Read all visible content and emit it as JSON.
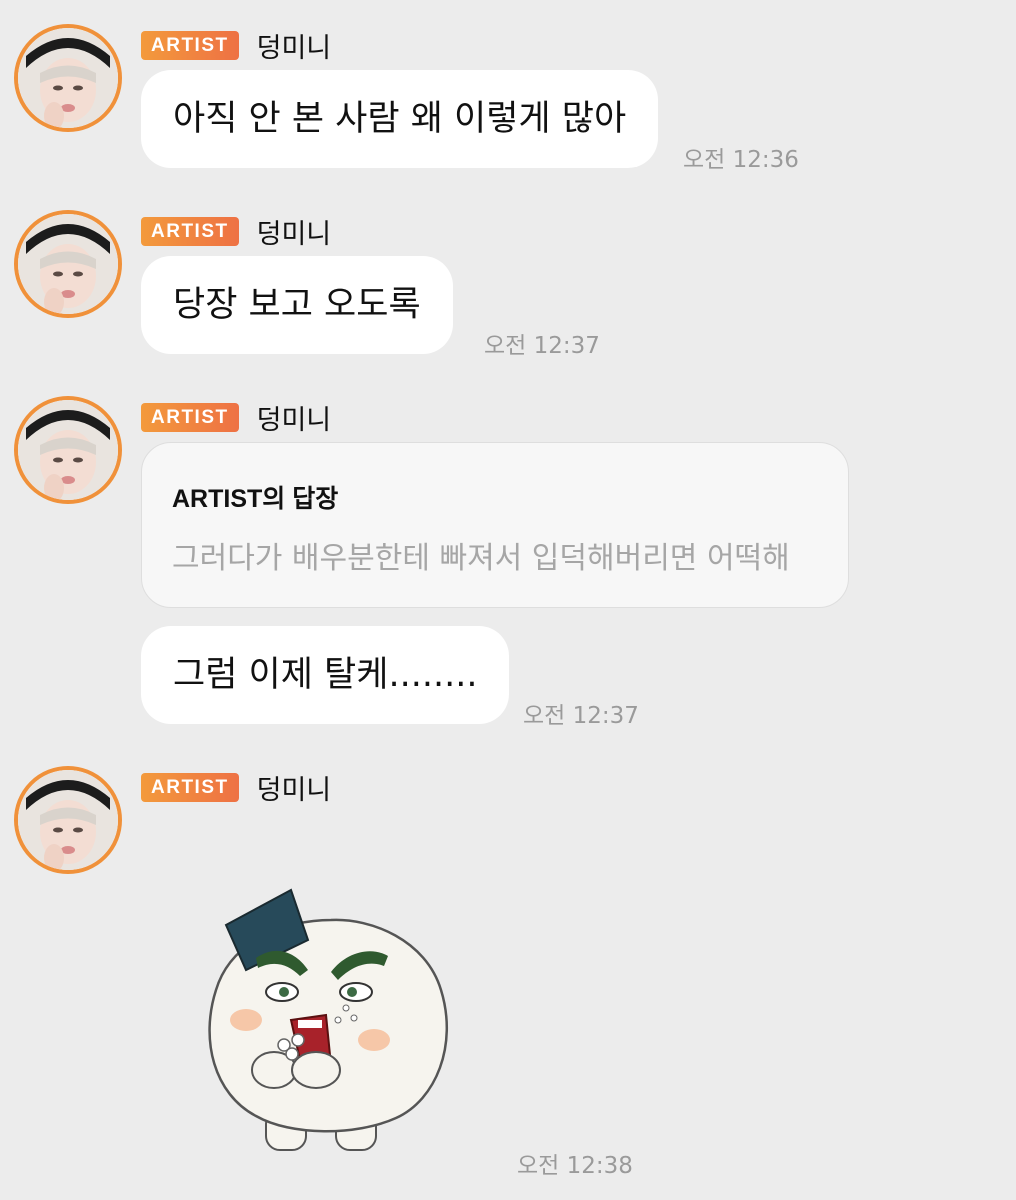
{
  "messages": [
    {
      "badge": "ARTIST",
      "name": "덩미니",
      "text": "아직 안 본 사람 왜 이렇게 많아",
      "time": "오전 12:36"
    },
    {
      "badge": "ARTIST",
      "name": "덩미니",
      "text": "당장 보고 오도록",
      "time": "오전 12:37"
    },
    {
      "badge": "ARTIST",
      "name": "덩미니",
      "reply": {
        "title": "ARTIST의 답장",
        "quote": "그러다가 배우분한테 빠져서 입덕해버리면 어떡해"
      },
      "text": "그럼 이제 탈케........",
      "time": "오전 12:37"
    },
    {
      "badge": "ARTIST",
      "name": "덩미니",
      "sticker": "rice-ball-character-eating-sticker",
      "time": "오전 12:38"
    }
  ],
  "colors": {
    "background": "#ececec",
    "badge_start": "#f39a3c",
    "badge_end": "#ee7144",
    "avatar_ring": "#f0913a",
    "bubble": "#ffffff",
    "time": "#9a9a9a"
  }
}
